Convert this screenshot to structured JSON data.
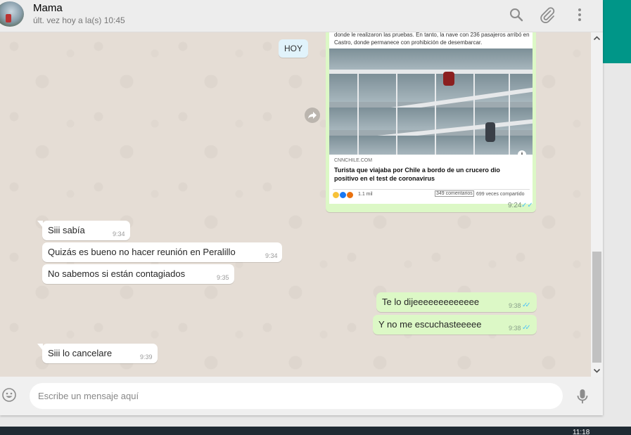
{
  "header": {
    "contact_name": "Mama",
    "last_seen": "últ. vez hoy a la(s) 10:45",
    "icons": [
      "search-icon",
      "attach-icon",
      "menu-icon"
    ]
  },
  "date_divider": "HOY",
  "link_card": {
    "description": "donde le realizaron las pruebas. En tanto, la nave con 236 pasajeros arribó en Castro, donde permanece con prohibición de desembarcar.",
    "source": "CNNCHILE.COM",
    "title": "Turista que viajaba por Chile a bordo de un crucero dio positivo en el test de coronavirus",
    "reactions_count": "1.1 mil",
    "comments": "349 comentarios",
    "shares": "699 veces compartido",
    "time": "9:24",
    "ticks": "✓✓"
  },
  "messages": [
    {
      "direction": "in",
      "text": "Siii sabía",
      "time": "9:34"
    },
    {
      "direction": "in",
      "text": "Quizás es bueno no hacer reunión en Peralillo",
      "time": "9:34"
    },
    {
      "direction": "in",
      "text": "No sabemos si están contagiados",
      "time": "9:35"
    },
    {
      "direction": "out",
      "text": "Te lo dijeeeeeeeeeeeee",
      "time": "9:38",
      "ticks": "✓✓"
    },
    {
      "direction": "out",
      "text": "Y no me escuchasteeeee",
      "time": "9:38",
      "ticks": "✓✓"
    },
    {
      "direction": "in",
      "text": "Siii lo cancelare",
      "time": "9:39"
    }
  ],
  "composer": {
    "placeholder": "Escribe un mensaje aquí"
  },
  "taskbar": {
    "clock": "11:18"
  },
  "colors": {
    "accent_teal": "#009688",
    "outgoing_bubble": "#dcf8c6",
    "incoming_bubble": "#ffffff",
    "read_ticks": "#4fc3f7"
  }
}
